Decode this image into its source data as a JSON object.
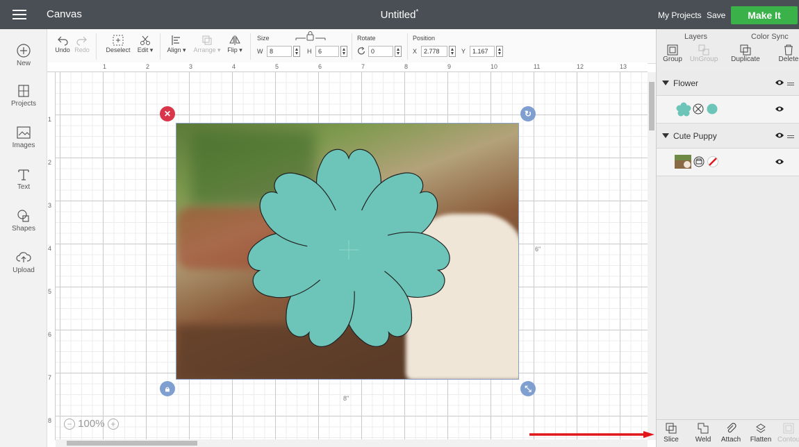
{
  "header": {
    "app_title": "Canvas",
    "doc_title": "Untitled",
    "doc_modified_mark": "*",
    "my_projects": "My Projects",
    "save": "Save",
    "make_it": "Make It"
  },
  "sidebar": {
    "items": [
      {
        "label": "New",
        "icon": "plus-circle-icon"
      },
      {
        "label": "Projects",
        "icon": "projects-icon"
      },
      {
        "label": "Images",
        "icon": "images-icon"
      },
      {
        "label": "Text",
        "icon": "text-icon"
      },
      {
        "label": "Shapes",
        "icon": "shapes-icon"
      },
      {
        "label": "Upload",
        "icon": "upload-icon"
      }
    ]
  },
  "toolbar": {
    "undo": "Undo",
    "redo": "Redo",
    "deselect": "Deselect",
    "edit": "Edit",
    "align": "Align",
    "arrange": "Arrange",
    "flip": "Flip",
    "size_label": "Size",
    "w_label": "W",
    "w_value": "8",
    "h_label": "H",
    "h_value": "6",
    "rotate_label": "Rotate",
    "rotate_value": "0",
    "position_label": "Position",
    "x_label": "X",
    "x_value": "2.778",
    "y_label": "Y",
    "y_value": "1.167"
  },
  "ruler": {
    "horizontal": [
      "1",
      "2",
      "3",
      "4",
      "5",
      "6",
      "7",
      "8",
      "9",
      "10",
      "11",
      "12",
      "13"
    ],
    "vertical": [
      "1",
      "2",
      "3",
      "4",
      "5",
      "6",
      "7",
      "8"
    ]
  },
  "canvas": {
    "width_label": "8\"",
    "height_label": "6\"",
    "zoom": "100%",
    "flower_color": "#6cc5b8",
    "selection_color": "#8aa0c6",
    "delete_handle_color": "#d9364a",
    "handle_color": "#7f9fd0"
  },
  "panel": {
    "tabs": [
      "Layers",
      "Color Sync"
    ],
    "tools": [
      {
        "label": "Group",
        "enabled": true
      },
      {
        "label": "UnGroup",
        "enabled": false
      },
      {
        "label": "Duplicate",
        "enabled": true
      },
      {
        "label": "Delete",
        "enabled": true
      }
    ],
    "groups": [
      {
        "name": "Flower"
      },
      {
        "name": "Cute Puppy"
      }
    ],
    "bottom_tools": [
      {
        "label": "Slice",
        "enabled": true
      },
      {
        "label": "Weld",
        "enabled": true
      },
      {
        "label": "Attach",
        "enabled": true
      },
      {
        "label": "Flatten",
        "enabled": true
      },
      {
        "label": "Contour",
        "enabled": false
      }
    ]
  },
  "annotation": {
    "arrow_color": "#e0161b"
  }
}
